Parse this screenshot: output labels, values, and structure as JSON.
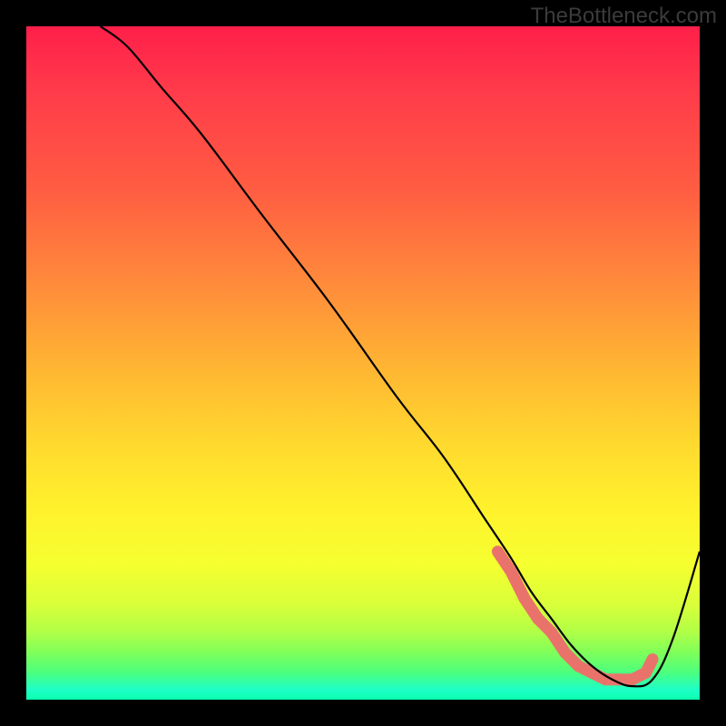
{
  "watermark": "TheBottleneck.com",
  "chart_data": {
    "type": "line",
    "title": "",
    "xlabel": "",
    "ylabel": "",
    "xlim": [
      0,
      100
    ],
    "ylim": [
      0,
      100
    ],
    "series": [
      {
        "name": "bottleneck-curve",
        "x": [
          11,
          15,
          20,
          26,
          35,
          45,
          55,
          62,
          68,
          72,
          75,
          78,
          81,
          84,
          87,
          90,
          93,
          96,
          100
        ],
        "values": [
          100,
          97,
          91,
          84,
          72,
          59,
          45,
          36,
          27,
          21,
          16,
          12,
          8,
          5,
          3,
          2,
          3,
          9,
          22
        ]
      }
    ],
    "markers": {
      "name": "highlight-band",
      "x": [
        70,
        72,
        74,
        76,
        78,
        80,
        82,
        84,
        86,
        88,
        90,
        92,
        93
      ],
      "values": [
        22,
        19,
        15,
        12,
        10,
        7,
        5,
        4,
        3,
        3,
        3,
        4,
        6
      ]
    },
    "gradient_stops": [
      {
        "offset": 0,
        "color": "#ff1f4a"
      },
      {
        "offset": 0.1,
        "color": "#ff3c4a"
      },
      {
        "offset": 0.24,
        "color": "#ff5c42"
      },
      {
        "offset": 0.38,
        "color": "#ff8a3b"
      },
      {
        "offset": 0.5,
        "color": "#ffb333"
      },
      {
        "offset": 0.62,
        "color": "#ffd92e"
      },
      {
        "offset": 0.72,
        "color": "#fff22c"
      },
      {
        "offset": 0.8,
        "color": "#f5ff30"
      },
      {
        "offset": 0.86,
        "color": "#d8ff3a"
      },
      {
        "offset": 0.9,
        "color": "#b0ff47"
      },
      {
        "offset": 0.93,
        "color": "#7fff5a"
      },
      {
        "offset": 0.96,
        "color": "#4bff7e"
      },
      {
        "offset": 0.985,
        "color": "#1effc8"
      },
      {
        "offset": 1.0,
        "color": "#0bffad"
      }
    ]
  }
}
